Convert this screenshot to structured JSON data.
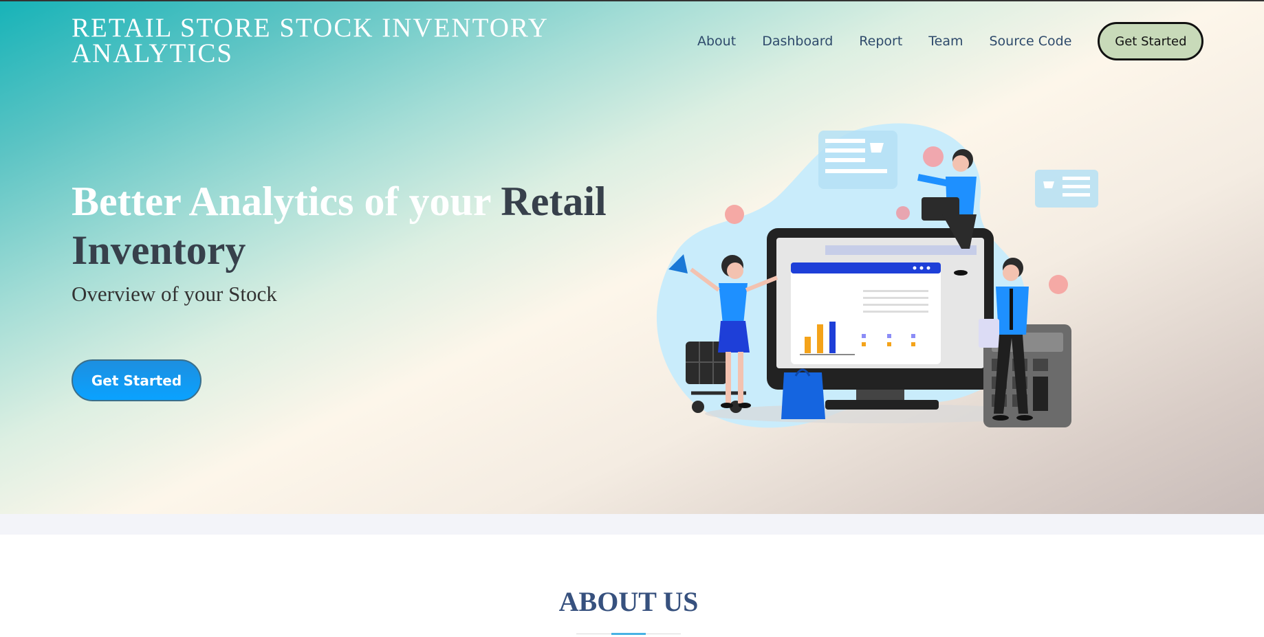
{
  "header": {
    "brand_line1": "RETAIL STORE STOCK INVENTORY",
    "brand_line2": "ANALYTICS",
    "nav": {
      "about": "About",
      "dashboard": "Dashboard",
      "report": "Report",
      "team": "Team",
      "source_code": "Source Code",
      "cta": "Get Started"
    }
  },
  "hero": {
    "headline_light": "Better Analytics of your ",
    "headline_dark_1": "Retail",
    "headline_dark_2": "Inventory",
    "subtitle": "Overview of your Stock",
    "cta": "Get Started"
  },
  "about": {
    "title": "ABOUT US"
  },
  "colors": {
    "brand_text": "#ffffff",
    "nav_text": "#2e4a6b",
    "nav_cta_bg": "#c8dab9",
    "hero_cta_bg": "#0aa2ff",
    "about_title": "#37517e",
    "about_accent": "#47b2e4"
  },
  "icons": {
    "illustration": "retail-analytics-illustration"
  }
}
